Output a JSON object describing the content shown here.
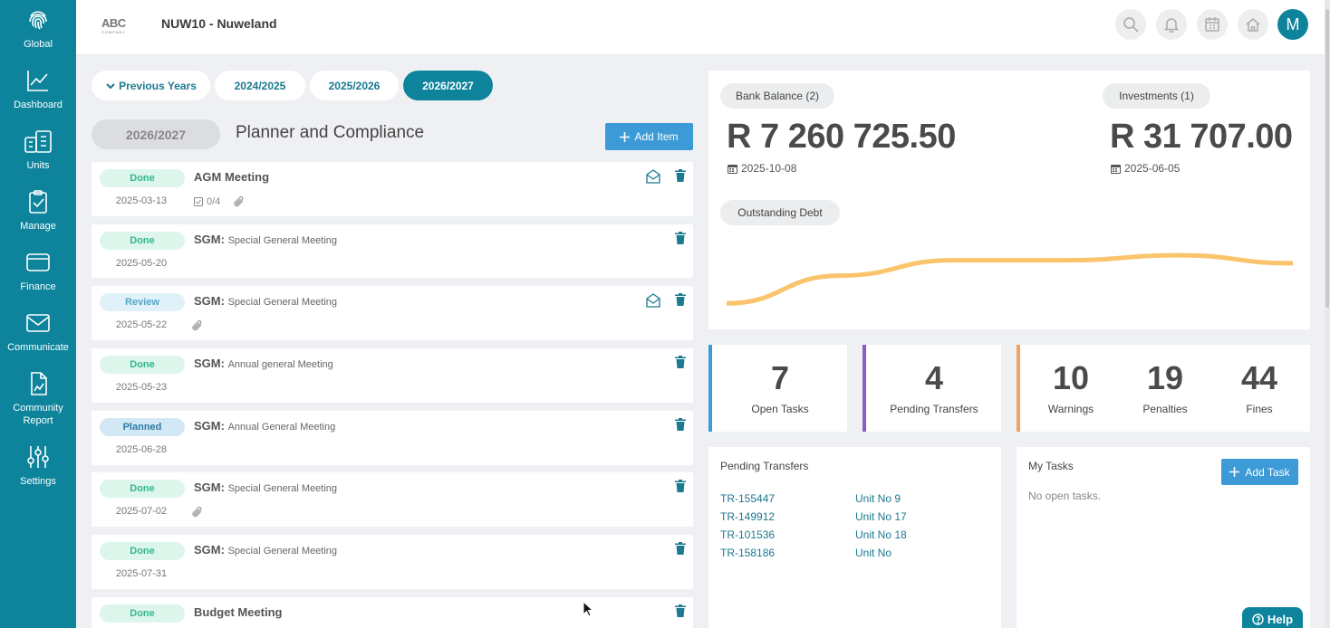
{
  "sidebar": {
    "items": [
      {
        "label": "Global",
        "icon": "fingerprint-icon"
      },
      {
        "label": "Dashboard",
        "icon": "chart-line-icon"
      },
      {
        "label": "Units",
        "icon": "building-icon"
      },
      {
        "label": "Manage",
        "icon": "clipboard-check-icon"
      },
      {
        "label": "Finance",
        "icon": "wallet-icon"
      },
      {
        "label": "Communicate",
        "icon": "envelope-icon"
      },
      {
        "label": "Community",
        "label2": "Report",
        "icon": "report-icon"
      },
      {
        "label": "Settings",
        "icon": "sliders-icon"
      }
    ]
  },
  "header": {
    "logo": "ABC",
    "logo_sub": "COMPANY",
    "title": "NUW10 - Nuweland",
    "avatar_initial": "M"
  },
  "years": {
    "previous": "Previous Years",
    "tabs": [
      "2024/2025",
      "2025/2026",
      "2026/2027"
    ],
    "active": "2026/2027"
  },
  "planner": {
    "year_pill": "2026/2027",
    "title": "Planner and Compliance",
    "add_item": "Add Item",
    "items": [
      {
        "status": "Done",
        "date": "2025-03-13",
        "title": "AGM Meeting",
        "subtitle": "",
        "checklist": "0/4"
      },
      {
        "status": "Done",
        "date": "2025-05-20",
        "title": "SGM:",
        "subtitle": "Special General Meeting"
      },
      {
        "status": "Review",
        "date": "2025-05-22",
        "title": "SGM:",
        "subtitle": "Special General Meeting"
      },
      {
        "status": "Done",
        "date": "2025-05-23",
        "title": "SGM:",
        "subtitle": "Annual general Meeting"
      },
      {
        "status": "Planned",
        "date": "2025-06-28",
        "title": "SGM:",
        "subtitle": "Annual General Meeting"
      },
      {
        "status": "Done",
        "date": "2025-07-02",
        "title": "SGM:",
        "subtitle": "Special General Meeting"
      },
      {
        "status": "Done",
        "date": "2025-07-31",
        "title": "SGM:",
        "subtitle": "Special General Meeting"
      },
      {
        "status": "Done",
        "date": "",
        "title": "Budget Meeting",
        "subtitle": ""
      }
    ]
  },
  "balances": {
    "bank_label": "Bank Balance (2)",
    "bank_amount": "R 7 260 725.50",
    "bank_date": "2025-10-08",
    "investments_label": "Investments (1)",
    "investments_amount": "R 31 707.00",
    "investments_date": "2025-06-05",
    "debt_label": "Outstanding Debt"
  },
  "chart_data": {
    "type": "line",
    "series": [
      {
        "values": [
          0.1,
          0.55,
          0.8,
          0.8,
          0.88,
          0.75
        ]
      }
    ],
    "color": "#f9c46b",
    "ylim": [
      0,
      1
    ]
  },
  "stats": {
    "open_tasks": {
      "value": "7",
      "label": "Open Tasks",
      "color": "#3c9ad7"
    },
    "pending_transfers": {
      "value": "4",
      "label": "Pending Transfers",
      "color": "#8a5cc7"
    },
    "warnings": {
      "value": "10",
      "label": "Warnings",
      "color": "#f0a45c"
    },
    "penalties": {
      "value": "19",
      "label": "Penalties"
    },
    "fines": {
      "value": "44",
      "label": "Fines"
    }
  },
  "transfers": {
    "heading": "Pending Transfers",
    "rows": [
      {
        "ref": "TR-155447",
        "unit": "Unit No 9"
      },
      {
        "ref": "TR-149912",
        "unit": "Unit No 17"
      },
      {
        "ref": "TR-101536",
        "unit": "Unit No 18"
      },
      {
        "ref": "TR-158186",
        "unit": "Unit No"
      }
    ]
  },
  "tasks": {
    "heading": "My Tasks",
    "add_task": "Add Task",
    "empty": "No open tasks."
  },
  "help": "Help"
}
